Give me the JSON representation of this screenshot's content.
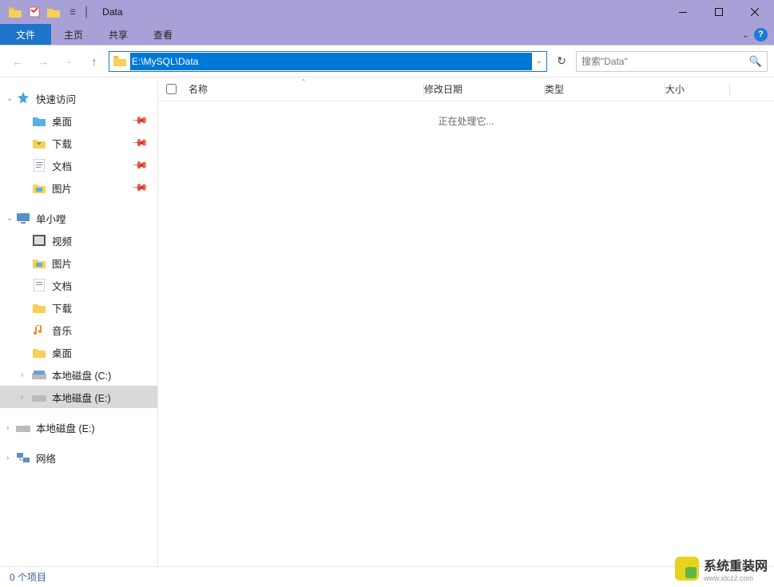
{
  "titlebar": {
    "title": "Data",
    "qat_sep": "|"
  },
  "tabs": {
    "file": "文件",
    "home": "主页",
    "share": "共享",
    "view": "查看"
  },
  "nav": {
    "path": "E:\\MySQL\\Data",
    "search_placeholder": "搜索\"Data\""
  },
  "sidebar": {
    "quick": "快速访问",
    "desktop": "桌面",
    "downloads": "下载",
    "documents": "文档",
    "pictures": "图片",
    "user": "单小嘡",
    "videos": "视频",
    "pictures2": "图片",
    "documents2": "文档",
    "downloads2": "下载",
    "music": "音乐",
    "desktop2": "桌面",
    "disk_c": "本地磁盘 (C:)",
    "disk_e": "本地磁盘 (E:)",
    "disk_e2": "本地磁盘 (E:)",
    "network": "网络"
  },
  "columns": {
    "name": "名称",
    "date": "修改日期",
    "type": "类型",
    "size": "大小"
  },
  "content": {
    "processing": "正在处理它..."
  },
  "status": {
    "items": "0 个项目"
  },
  "watermark": {
    "main": "系统重装网",
    "sub": "www.xtcz2.com"
  }
}
